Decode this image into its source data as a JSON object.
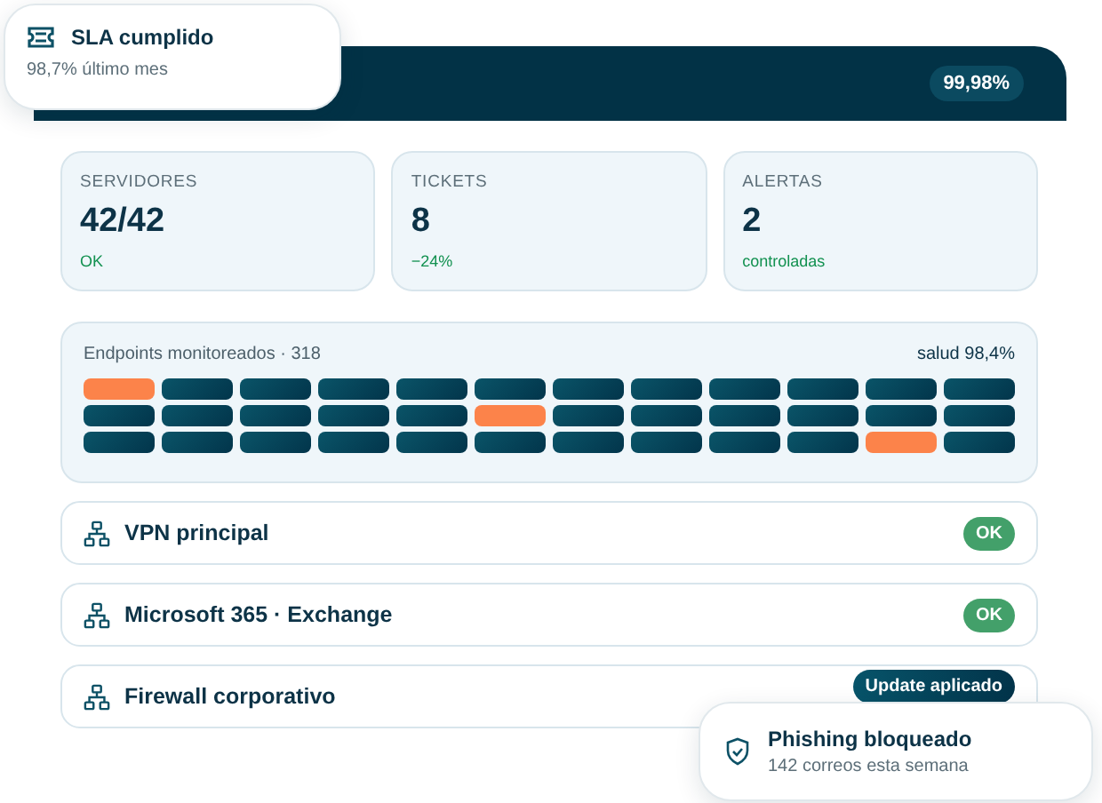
{
  "sla_toast": {
    "title": "SLA cumplido",
    "subtitle": "98,7% último mes"
  },
  "header": {
    "badge": "99,98%"
  },
  "stats": [
    {
      "label": "SERVIDORES",
      "value": "42/42",
      "note": "OK"
    },
    {
      "label": "TICKETS",
      "value": "8",
      "note": "−24%"
    },
    {
      "label": "ALERTAS",
      "value": "2",
      "note": "controladas"
    }
  ],
  "endpoints": {
    "title": "Endpoints monitoreados · 318",
    "health": "salud 98,4%",
    "rows": [
      [
        {
          "alert": true
        },
        {
          "alert": false
        },
        {
          "alert": false
        },
        {
          "alert": false
        },
        {
          "alert": false
        },
        {
          "alert": false
        },
        {
          "alert": false
        },
        {
          "alert": false
        },
        {
          "alert": false
        },
        {
          "alert": false
        },
        {
          "alert": false
        },
        {
          "alert": false
        }
      ],
      [
        {
          "alert": false
        },
        {
          "alert": false
        },
        {
          "alert": false
        },
        {
          "alert": false
        },
        {
          "alert": false
        },
        {
          "alert": true
        },
        {
          "alert": false
        },
        {
          "alert": false
        },
        {
          "alert": false
        },
        {
          "alert": false
        },
        {
          "alert": false
        },
        {
          "alert": false
        }
      ],
      [
        {
          "alert": false
        },
        {
          "alert": false
        },
        {
          "alert": false
        },
        {
          "alert": false
        },
        {
          "alert": false
        },
        {
          "alert": false
        },
        {
          "alert": false
        },
        {
          "alert": false
        },
        {
          "alert": false
        },
        {
          "alert": false
        },
        {
          "alert": true
        },
        {
          "alert": false
        }
      ]
    ]
  },
  "services": [
    {
      "name": "VPN principal",
      "status": "OK",
      "kind": "ok"
    },
    {
      "name": "Microsoft 365 · Exchange",
      "status": "OK",
      "kind": "ok"
    },
    {
      "name": "Firewall corporativo",
      "status": "Update aplicado",
      "kind": "update"
    }
  ],
  "phishing_toast": {
    "title": "Phishing bloqueado",
    "subtitle": "142 correos esta semana"
  }
}
